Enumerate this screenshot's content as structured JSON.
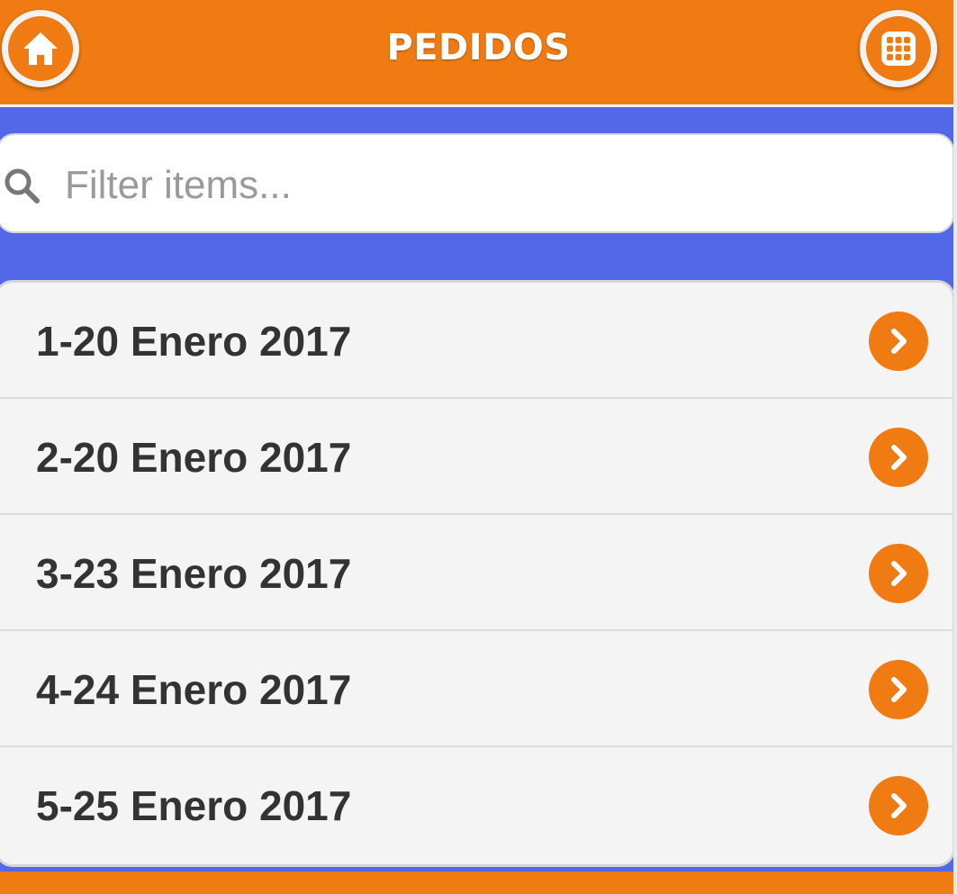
{
  "header": {
    "title": "PEDIDOS",
    "home_icon": "home-icon",
    "grid_icon": "grid-menu-icon"
  },
  "search": {
    "placeholder": "Filter items...",
    "value": "",
    "icon": "search-icon"
  },
  "list": {
    "items": [
      {
        "label": "1-20 Enero 2017"
      },
      {
        "label": "2-20 Enero 2017"
      },
      {
        "label": "3-23 Enero 2017"
      },
      {
        "label": "4-24 Enero 2017"
      },
      {
        "label": "5-25 Enero 2017"
      }
    ],
    "item_icon": "chevron-right-icon"
  },
  "colors": {
    "accent": "#f07b13",
    "background": "#5268e9",
    "list_bg": "#f4f4f4",
    "text": "#333333"
  }
}
